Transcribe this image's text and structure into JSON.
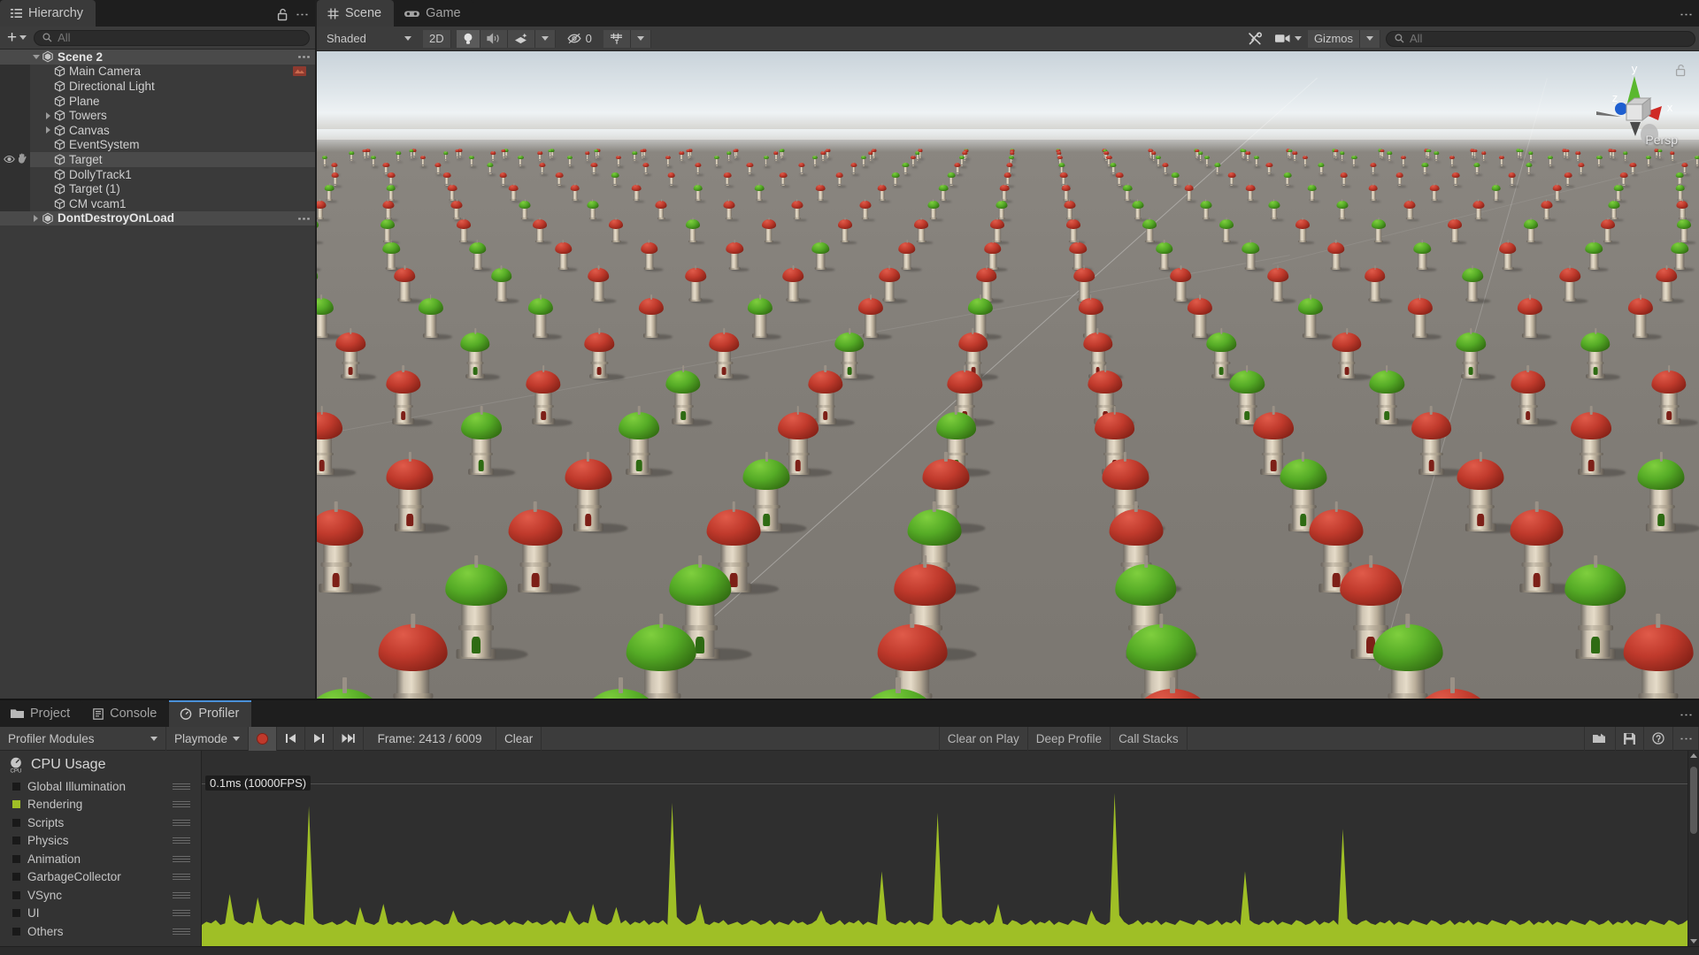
{
  "hierarchy": {
    "tab_label": "Hierarchy",
    "tab_icon": "hierarchy-icon",
    "lock_icon": "lock-open-icon",
    "menu_icon": "kebab-menu-icon",
    "create_label": "+",
    "search": {
      "placeholder": "All",
      "value": "",
      "icon": "search-icon"
    },
    "items": [
      {
        "label": "Scene 2",
        "depth": 0,
        "icon": "unity-scene-icon",
        "twisty": "down",
        "selected": true,
        "kebab": true
      },
      {
        "label": "Main Camera",
        "depth": 1,
        "icon": "gameobject-cube-icon",
        "twisty": "none",
        "badge": "camera-preview-icon"
      },
      {
        "label": "Directional Light",
        "depth": 1,
        "icon": "gameobject-cube-icon",
        "twisty": "none"
      },
      {
        "label": "Plane",
        "depth": 1,
        "icon": "gameobject-cube-icon",
        "twisty": "none"
      },
      {
        "label": "Towers",
        "depth": 1,
        "icon": "gameobject-cube-icon",
        "twisty": "right"
      },
      {
        "label": "Canvas",
        "depth": 1,
        "icon": "gameobject-cube-icon",
        "twisty": "right"
      },
      {
        "label": "EventSystem",
        "depth": 1,
        "icon": "gameobject-cube-icon",
        "twisty": "none"
      },
      {
        "label": "Target",
        "depth": 1,
        "icon": "gameobject-cube-icon",
        "twisty": "none",
        "hover": true,
        "visibility_icon": "eye-icon",
        "pickability_icon": "hand-icon"
      },
      {
        "label": "DollyTrack1",
        "depth": 1,
        "icon": "gameobject-cube-icon",
        "twisty": "none"
      },
      {
        "label": "Target (1)",
        "depth": 1,
        "icon": "gameobject-cube-icon",
        "twisty": "none"
      },
      {
        "label": "CM vcam1",
        "depth": 1,
        "icon": "gameobject-cube-icon",
        "twisty": "none"
      },
      {
        "label": "DontDestroyOnLoad",
        "depth": 0,
        "icon": "unity-scene-icon",
        "twisty": "right",
        "selected": true,
        "kebab": true
      }
    ]
  },
  "scene": {
    "tabs": [
      {
        "label": "Scene",
        "icon": "grid-icon",
        "active": true
      },
      {
        "label": "Game",
        "icon": "gamepad-icon",
        "active": false
      }
    ],
    "menu_icon": "kebab-menu-icon",
    "toolbar": {
      "draw_mode": "Shaded",
      "mode_2d": "2D",
      "lighting_icon": "light-bulb-icon",
      "audio_icon": "speaker-icon",
      "fx_icon": "effects-icon",
      "hidden_objects_label": "0",
      "hidden_objects_icon": "eye-crossed-icon",
      "grid_icon": "grid-visibility-icon",
      "tools_icon": "tools-icon",
      "camera_icon": "scene-camera-icon",
      "gizmos_label": "Gizmos",
      "search": {
        "placeholder": "All",
        "value": "",
        "icon": "search-icon"
      }
    },
    "gizmo": {
      "axis_x": "x",
      "axis_y": "y",
      "axis_z": "z",
      "projection_label": "Persp"
    },
    "content_description": "3D scene of a large grid of fantasy towers with red and green conical roofs on a gray plane"
  },
  "profiler": {
    "tabs": [
      {
        "label": "Project",
        "icon": "folder-icon",
        "active": false
      },
      {
        "label": "Console",
        "icon": "console-icon",
        "active": false
      },
      {
        "label": "Profiler",
        "icon": "profiler-icon",
        "active": true
      }
    ],
    "menu_icon": "kebab-menu-icon",
    "toolbar": {
      "modules_label": "Profiler Modules",
      "target_label": "Playmode",
      "record_icon": "record-button-icon",
      "first_frame_icon": "first-frame-icon",
      "prev_frame_icon": "step-frame-icon",
      "last_frame_icon": "last-frame-icon",
      "frame_label": "Frame: 2413 / 6009",
      "clear_label": "Clear",
      "clear_on_play_label": "Clear on Play",
      "deep_profile_label": "Deep Profile",
      "call_stacks_label": "Call Stacks",
      "load_icon": "load-icon",
      "save_icon": "save-icon",
      "help_icon": "help-icon",
      "more_icon": "kebab-menu-icon"
    },
    "module": {
      "title": "CPU Usage",
      "title_icon": "cpu-icon",
      "chart_scale_label": "0.1ms (10000FPS)",
      "series": [
        {
          "label": "Global Illumination",
          "enabled": false,
          "color": "#191919"
        },
        {
          "label": "Rendering",
          "enabled": true,
          "color": "#9fbf26"
        },
        {
          "label": "Scripts",
          "enabled": false,
          "color": "#191919"
        },
        {
          "label": "Physics",
          "enabled": false,
          "color": "#191919"
        },
        {
          "label": "Animation",
          "enabled": false,
          "color": "#191919"
        },
        {
          "label": "GarbageCollector",
          "enabled": false,
          "color": "#191919"
        },
        {
          "label": "VSync",
          "enabled": false,
          "color": "#191919"
        },
        {
          "label": "UI",
          "enabled": false,
          "color": "#191919"
        },
        {
          "label": "Others",
          "enabled": false,
          "color": "#191919"
        }
      ]
    }
  },
  "chart_data": {
    "type": "area",
    "title": "CPU Usage",
    "ylabel": "0.1ms (10000FPS)",
    "xlabel": "",
    "grid": true,
    "gridline_value": 0.1,
    "ylim": [
      0,
      0.12
    ],
    "legend_position": "left",
    "series": [
      {
        "name": "Rendering",
        "color": "#9fbf26",
        "values": [
          0.013,
          0.015,
          0.014,
          0.016,
          0.013,
          0.014,
          0.032,
          0.016,
          0.014,
          0.013,
          0.015,
          0.014,
          0.03,
          0.017,
          0.014,
          0.013,
          0.015,
          0.016,
          0.014,
          0.013,
          0.015,
          0.014,
          0.013,
          0.086,
          0.017,
          0.014,
          0.013,
          0.014,
          0.015,
          0.013,
          0.014,
          0.016,
          0.014,
          0.013,
          0.024,
          0.015,
          0.014,
          0.013,
          0.015,
          0.026,
          0.014,
          0.013,
          0.015,
          0.014,
          0.016,
          0.013,
          0.014,
          0.015,
          0.013,
          0.014,
          0.016,
          0.015,
          0.013,
          0.014,
          0.022,
          0.015,
          0.013,
          0.014,
          0.016,
          0.015,
          0.013,
          0.014,
          0.015,
          0.013,
          0.014,
          0.016,
          0.013,
          0.015,
          0.014,
          0.013,
          0.016,
          0.014,
          0.015,
          0.013,
          0.014,
          0.016,
          0.013,
          0.015,
          0.014,
          0.022,
          0.016,
          0.013,
          0.015,
          0.014,
          0.026,
          0.016,
          0.014,
          0.013,
          0.015,
          0.024,
          0.014,
          0.016,
          0.013,
          0.015,
          0.014,
          0.016,
          0.013,
          0.015,
          0.014,
          0.016,
          0.013,
          0.088,
          0.018,
          0.015,
          0.013,
          0.014,
          0.016,
          0.026,
          0.014,
          0.013,
          0.015,
          0.014,
          0.016,
          0.013,
          0.014,
          0.015,
          0.013,
          0.014,
          0.016,
          0.015,
          0.013,
          0.014,
          0.016,
          0.013,
          0.015,
          0.014,
          0.013,
          0.016,
          0.014,
          0.015,
          0.013,
          0.014,
          0.016,
          0.022,
          0.015,
          0.013,
          0.014,
          0.016,
          0.013,
          0.015,
          0.014,
          0.016,
          0.013,
          0.015,
          0.014,
          0.013,
          0.046,
          0.016,
          0.014,
          0.013,
          0.015,
          0.014,
          0.016,
          0.013,
          0.015,
          0.014,
          0.013,
          0.016,
          0.082,
          0.018,
          0.014,
          0.013,
          0.015,
          0.016,
          0.014,
          0.013,
          0.015,
          0.014,
          0.016,
          0.013,
          0.015,
          0.026,
          0.014,
          0.013,
          0.016,
          0.015,
          0.013,
          0.014,
          0.016,
          0.013,
          0.015,
          0.014,
          0.016,
          0.013,
          0.015,
          0.014,
          0.013,
          0.016,
          0.015,
          0.014,
          0.013,
          0.022,
          0.016,
          0.014,
          0.013,
          0.015,
          0.094,
          0.019,
          0.015,
          0.013,
          0.014,
          0.016,
          0.013,
          0.015,
          0.014,
          0.016,
          0.013,
          0.015,
          0.014,
          0.013,
          0.016,
          0.015,
          0.014,
          0.013,
          0.016,
          0.015,
          0.013,
          0.014,
          0.016,
          0.013,
          0.015,
          0.014,
          0.016,
          0.013,
          0.046,
          0.016,
          0.014,
          0.013,
          0.015,
          0.014,
          0.016,
          0.013,
          0.015,
          0.014,
          0.013,
          0.016,
          0.015,
          0.013,
          0.014,
          0.016,
          0.013,
          0.015,
          0.014,
          0.016,
          0.013,
          0.072,
          0.017,
          0.014,
          0.013,
          0.015,
          0.016,
          0.014,
          0.013,
          0.015,
          0.014,
          0.016,
          0.013,
          0.015,
          0.014,
          0.013,
          0.016,
          0.015,
          0.014,
          0.013,
          0.016,
          0.015,
          0.013,
          0.014,
          0.016,
          0.013,
          0.015,
          0.014,
          0.016,
          0.013,
          0.015,
          0.014,
          0.013,
          0.016,
          0.015,
          0.014,
          0.013,
          0.016,
          0.015,
          0.013,
          0.014,
          0.016,
          0.013,
          0.015,
          0.014,
          0.016,
          0.013,
          0.015,
          0.014,
          0.013,
          0.016,
          0.015,
          0.014,
          0.013,
          0.016,
          0.015,
          0.013,
          0.014,
          0.016,
          0.013,
          0.015,
          0.014,
          0.016,
          0.013,
          0.015,
          0.014,
          0.013,
          0.016,
          0.015,
          0.014,
          0.013,
          0.016,
          0.015,
          0.013,
          0.014,
          0.016
        ]
      }
    ]
  }
}
